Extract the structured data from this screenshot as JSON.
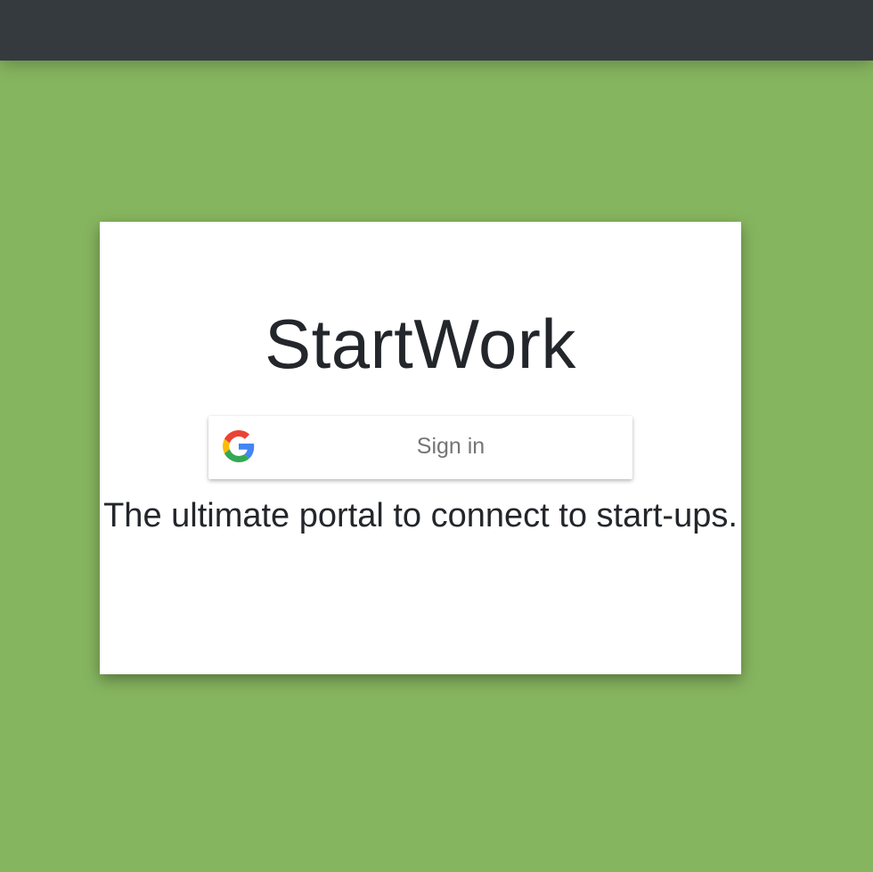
{
  "app": {
    "name": "StartWork"
  },
  "signin": {
    "label": "Sign in",
    "icon": "google-g-icon"
  },
  "tagline": "The ultimate portal to connect to start-ups.",
  "colors": {
    "background": "#86b55f",
    "topbar": "#353a3f",
    "card": "#ffffff",
    "text": "#23262a",
    "button_text": "#757575"
  }
}
